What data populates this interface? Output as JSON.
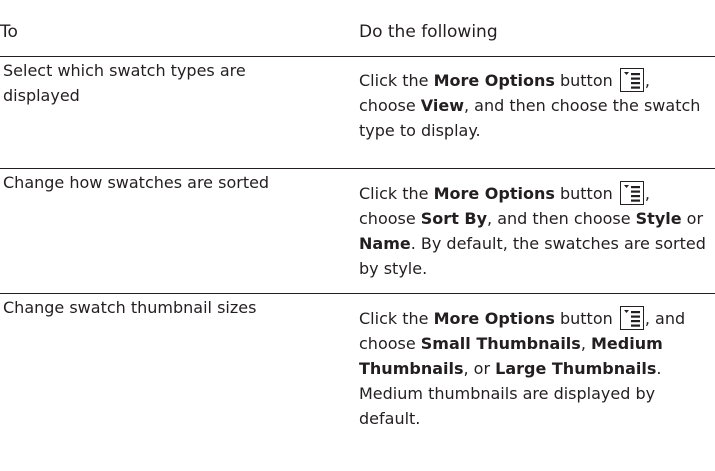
{
  "header": {
    "col_to": "To",
    "col_do": "Do the following"
  },
  "rows": [
    {
      "to": "Select which swatch types are displayed",
      "p1": "Click the ",
      "b1": "More Options",
      "p2": " button ",
      "p3": ", choose ",
      "b2": "View",
      "p4": ", and then choose the swatch type to display."
    },
    {
      "to": "Change how swatches are sorted",
      "p1": "Click the ",
      "b1": "More Options",
      "p2": " button ",
      "p3": ", choose ",
      "b2": "Sort By",
      "p4": ", and then choose ",
      "b3": "Style",
      "p5": " or ",
      "b4": "Name",
      "p6": ". By default, the swatches are sorted by style."
    },
    {
      "to": "Change swatch thumbnail sizes",
      "p1": "Click the ",
      "b1": "More Options",
      "p2": " button ",
      "p3": ", and choose ",
      "b2": "Small Thumbnails",
      "p4": ", ",
      "b3": "Medium Thumbnails",
      "p5": ", or ",
      "b4": "Large Thumbnails",
      "p6": ". Medium thumbnails are displayed by default."
    }
  ],
  "icons": {
    "more_options": "more-options-icon"
  }
}
